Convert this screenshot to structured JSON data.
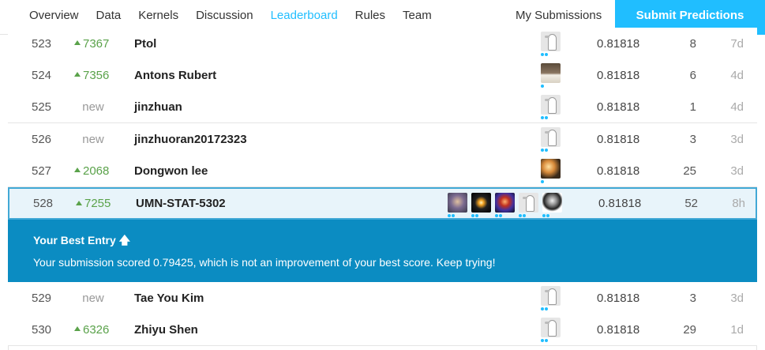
{
  "nav": {
    "tabs": [
      {
        "label": "Overview"
      },
      {
        "label": "Data"
      },
      {
        "label": "Kernels"
      },
      {
        "label": "Discussion"
      },
      {
        "label": "Leaderboard"
      },
      {
        "label": "Rules"
      },
      {
        "label": "Team"
      }
    ],
    "active_tab": "Leaderboard",
    "my_submissions": "My Submissions",
    "submit_button": "Submit Predictions"
  },
  "colors": {
    "accent": "#20beff",
    "banner": "#0b8cc2",
    "up": "#5aa24a",
    "highlight_bg": "#e8f4fa"
  },
  "rows": [
    {
      "rank": "523",
      "change": "7367",
      "change_type": "up",
      "name": "Ptol",
      "avatars": [
        "goose-icon"
      ],
      "score": "0.81818",
      "entries": "8",
      "last": "7d"
    },
    {
      "rank": "524",
      "change": "7356",
      "change_type": "up",
      "name": "Antons Rubert",
      "avatars": [
        "photo-avatar"
      ],
      "score": "0.81818",
      "entries": "6",
      "last": "4d"
    },
    {
      "rank": "525",
      "change": "new",
      "change_type": "new",
      "name": "jinzhuan",
      "avatars": [
        "goose-icon"
      ],
      "score": "0.81818",
      "entries": "1",
      "last": "4d"
    },
    {
      "rank": "526",
      "change": "new",
      "change_type": "new",
      "name": "jinzhuoran20172323",
      "avatars": [
        "goose-icon"
      ],
      "score": "0.81818",
      "entries": "3",
      "last": "3d"
    },
    {
      "rank": "527",
      "change": "2068",
      "change_type": "up",
      "name": "Dongwon lee",
      "avatars": [
        "photo-avatar"
      ],
      "score": "0.81818",
      "entries": "25",
      "last": "3d"
    },
    {
      "rank": "528",
      "change": "7255",
      "change_type": "up",
      "name": "UMN-STAT-5302",
      "avatars": [
        "photo-avatar",
        "photo-avatar",
        "photo-avatar",
        "goose-icon",
        "photo-avatar"
      ],
      "score": "0.81818",
      "entries": "52",
      "last": "8h",
      "highlight": true
    }
  ],
  "best_entry": {
    "title": "Your Best Entry",
    "arrow": "🡅",
    "message": "Your submission scored 0.79425, which is not an improvement of your best score. Keep trying!"
  },
  "rows_after": [
    {
      "rank": "529",
      "change": "new",
      "change_type": "new",
      "name": "Tae You Kim",
      "avatars": [
        "goose-icon"
      ],
      "score": "0.81818",
      "entries": "3",
      "last": "3d"
    },
    {
      "rank": "530",
      "change": "6326",
      "change_type": "up",
      "name": "Zhiyu Shen",
      "avatars": [
        "goose-icon"
      ],
      "score": "0.81818",
      "entries": "29",
      "last": "1d"
    }
  ]
}
